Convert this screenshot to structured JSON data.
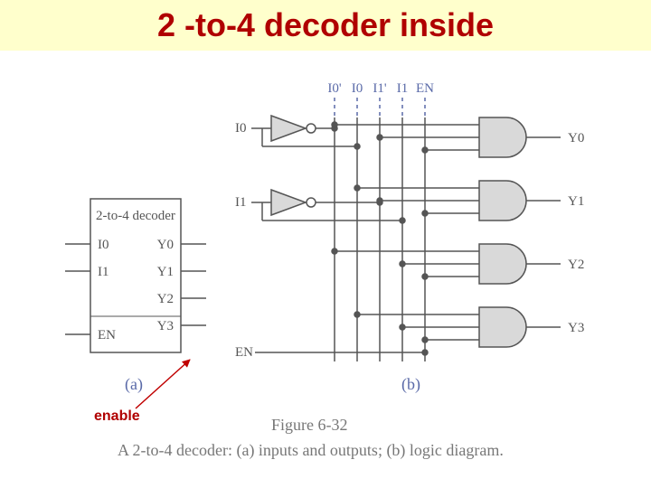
{
  "title": "2 -to-4 decoder inside",
  "enable_annotation": "enable",
  "caption_ref": "Figure 6-32",
  "caption_text": "A 2-to-4 decoder: (a) inputs and outputs; (b) logic diagram.",
  "sub_a": "(a)",
  "sub_b": "(b)",
  "block": {
    "name": "2-to-4 decoder",
    "inputs": [
      "I0",
      "I1",
      "EN"
    ],
    "outputs": [
      "Y0",
      "Y1",
      "Y2",
      "Y3"
    ]
  },
  "rails": [
    "I0'",
    "I0",
    "I1'",
    "I1",
    "EN"
  ],
  "circuit_inputs": [
    "I0",
    "I1",
    "EN"
  ],
  "circuit_outputs": [
    "Y0",
    "Y1",
    "Y2",
    "Y3"
  ]
}
